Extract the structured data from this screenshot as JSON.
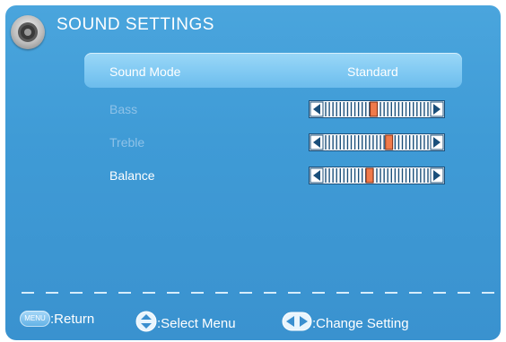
{
  "header": {
    "title": "SOUND SETTINGS",
    "icon": "speaker-icon"
  },
  "menu": {
    "items": [
      {
        "label": "Sound Mode",
        "value": "Standard",
        "selected": true
      },
      {
        "label": "Bass",
        "level": 0.47,
        "enabled": false
      },
      {
        "label": "Treble",
        "level": 0.62,
        "enabled": false
      },
      {
        "label": "Balance",
        "level": 0.43,
        "enabled": true
      }
    ]
  },
  "footer": {
    "menu_key_label": "MENU",
    "return_label": ":Return",
    "select_label": ":Select Menu",
    "change_label": ":Change Setting"
  },
  "colors": {
    "background": "#3f9bd6",
    "highlight": "#7ec8f2",
    "slider_thumb": "#f07a4a",
    "disabled_text": "#8ec2e8"
  }
}
